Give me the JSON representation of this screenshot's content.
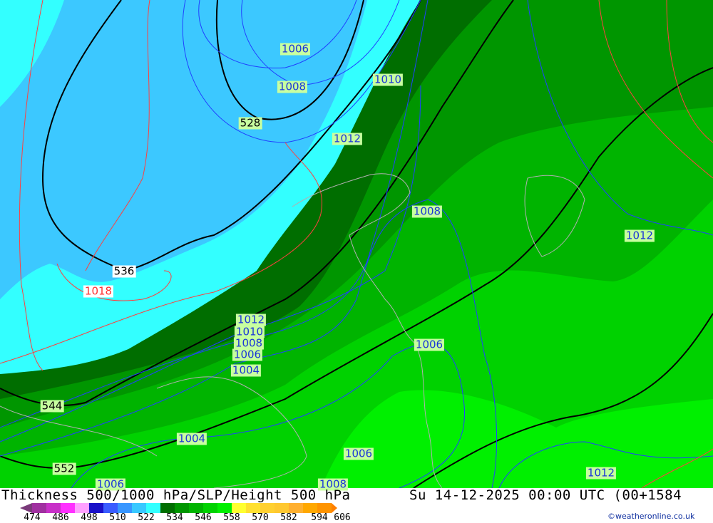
{
  "title": "Thickness 500/1000 hPa/SLP/Height 500 hPa",
  "datetime": "Su 14-12-2025 00:00 UTC (00+1584",
  "credit": "©weatheronline.co.uk",
  "legend": {
    "ticks": [
      "474",
      "486",
      "498",
      "510",
      "522",
      "534",
      "546",
      "558",
      "570",
      "582",
      "594",
      "606"
    ],
    "colors": [
      "#7a3a7a",
      "#a030a0",
      "#c830c8",
      "#ff30ff",
      "#ffa0ff",
      "#1a10c8",
      "#3a5cff",
      "#3896ff",
      "#38c8ff",
      "#33ffff",
      "#006e00",
      "#009600",
      "#00b400",
      "#00d200",
      "#00f000",
      "#ffff30",
      "#ffe030",
      "#ffd030",
      "#ffc830",
      "#ffb030",
      "#ffa800",
      "#ff9400",
      "#ff8000"
    ]
  },
  "map_colors": {
    "cyan": "#33ffff",
    "lightblue": "#3cc8ff",
    "dark_green": "#006e00",
    "green1": "#009600",
    "green2": "#00b400",
    "green3": "#00d200",
    "green4": "#00f000"
  },
  "isobar_labels": [
    "1006",
    "1008",
    "1010",
    "1012",
    "1008",
    "1012",
    "1012",
    "1010",
    "1008",
    "1006",
    "1004",
    "1006",
    "1004",
    "1006",
    "1012",
    "1006",
    "1008"
  ],
  "height_labels": [
    "528",
    "536",
    "544",
    "552"
  ],
  "thickness_labels": [
    "1018"
  ]
}
